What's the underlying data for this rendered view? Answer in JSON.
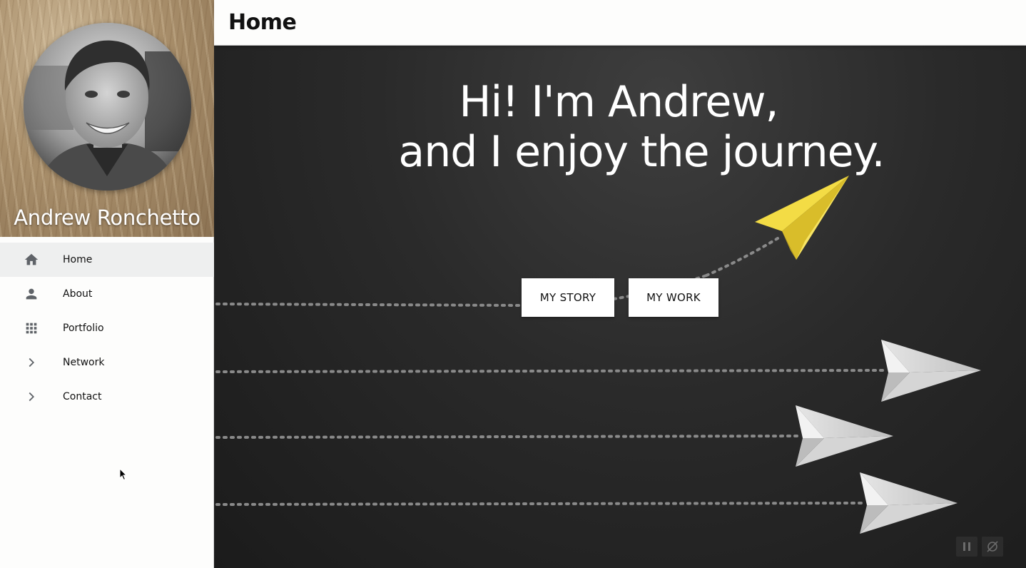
{
  "profile": {
    "name": "Andrew Ronchetto"
  },
  "nav": {
    "items": [
      {
        "label": "Home",
        "icon": "home-icon",
        "active": true
      },
      {
        "label": "About",
        "icon": "person-icon",
        "active": false
      },
      {
        "label": "Portfolio",
        "icon": "grid-icon",
        "active": false
      },
      {
        "label": "Network",
        "icon": "chevron-right-icon",
        "active": false
      },
      {
        "label": "Contact",
        "icon": "chevron-right-icon",
        "active": false
      }
    ]
  },
  "header": {
    "title": "Home"
  },
  "hero": {
    "headline_line1": "Hi! I'm Andrew,",
    "headline_line2": "and I enjoy the journey.",
    "buttons": {
      "story_label": "MY STORY",
      "work_label": "MY WORK"
    },
    "controls": {
      "pause_icon": "pause-icon",
      "motion_icon": "reduce-motion-icon"
    }
  },
  "colors": {
    "hero_background": "#232323",
    "accent_plane": "#f0d43a",
    "active_nav": "#eeefef"
  }
}
